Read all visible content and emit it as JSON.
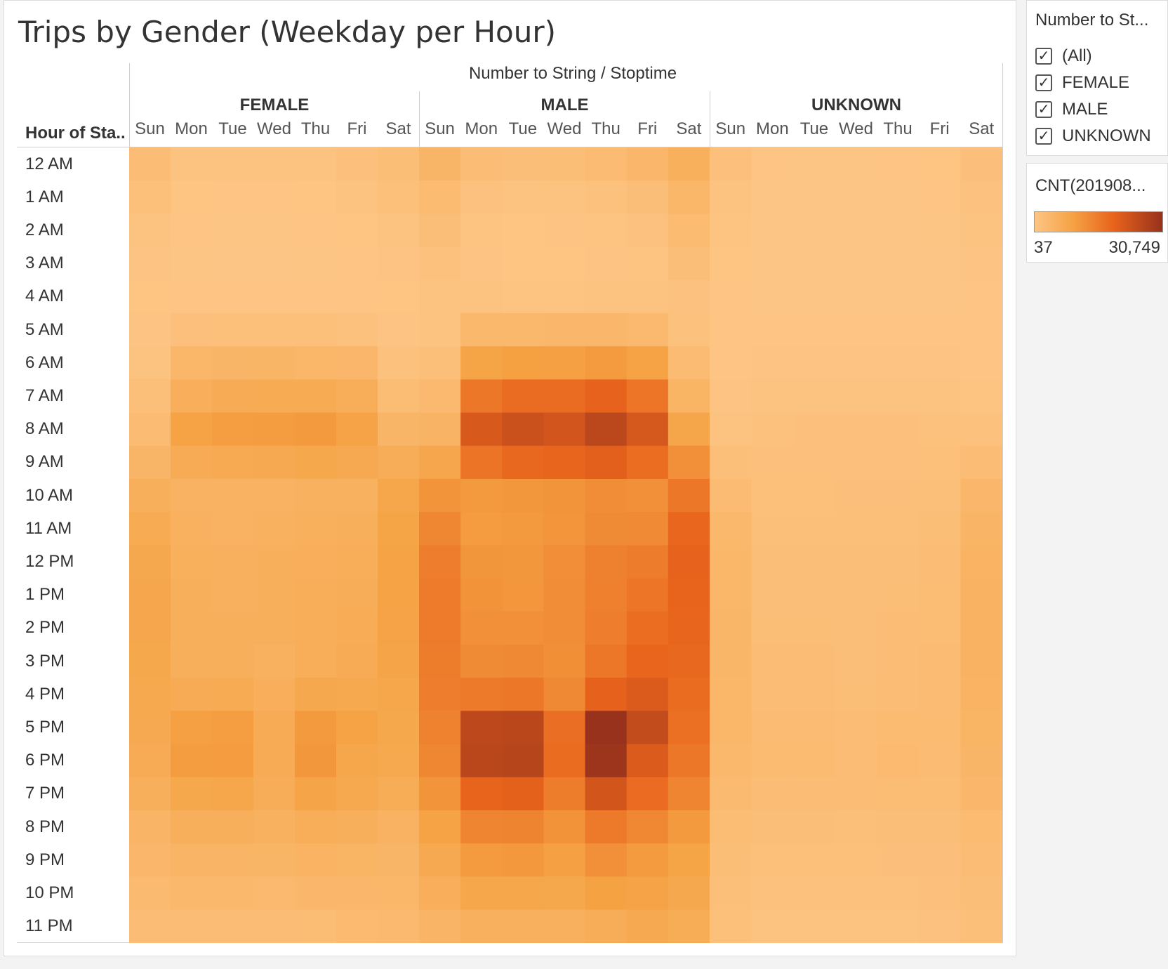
{
  "title": "Trips by Gender (Weekday per Hour)",
  "column_header": "Number to String / Stoptime",
  "row_header": "Hour of Sta..",
  "filter": {
    "title": "Number to St...",
    "items": [
      {
        "label": "(All)",
        "checked": true
      },
      {
        "label": "FEMALE",
        "checked": true
      },
      {
        "label": "MALE",
        "checked": true
      },
      {
        "label": "UNKNOWN",
        "checked": true
      }
    ]
  },
  "color_legend": {
    "title": "CNT(201908...",
    "min_label": "37",
    "max_label": "30,749",
    "colors": [
      "#fdc585",
      "#f5a243",
      "#e8631c",
      "#98321c"
    ]
  },
  "chart_data": {
    "type": "heatmap",
    "title": "Trips by Gender (Weekday per Hour)",
    "column_group_label": "Number to String / Stoptime",
    "row_label": "Hour of Sta..",
    "groups": [
      "FEMALE",
      "MALE",
      "UNKNOWN"
    ],
    "days": [
      "Sun",
      "Mon",
      "Tue",
      "Wed",
      "Thu",
      "Fri",
      "Sat"
    ],
    "hours": [
      "12 AM",
      "1 AM",
      "2 AM",
      "3 AM",
      "4 AM",
      "5 AM",
      "6 AM",
      "7 AM",
      "8 AM",
      "9 AM",
      "10 AM",
      "11 AM",
      "12 PM",
      "1 PM",
      "2 PM",
      "3 PM",
      "4 PM",
      "5 PM",
      "6 PM",
      "7 PM",
      "8 PM",
      "9 PM",
      "10 PM",
      "11 PM"
    ],
    "value_range": [
      37,
      30749
    ],
    "values": {
      "FEMALE": [
        [
          2200,
          900,
          700,
          700,
          900,
          1300,
          2000
        ],
        [
          1400,
          400,
          300,
          300,
          400,
          700,
          1400
        ],
        [
          900,
          200,
          150,
          150,
          200,
          400,
          900
        ],
        [
          500,
          150,
          100,
          100,
          150,
          200,
          500
        ],
        [
          400,
          250,
          200,
          200,
          250,
          250,
          400
        ],
        [
          450,
          1300,
          1400,
          1400,
          1400,
          1200,
          500
        ],
        [
          900,
          3800,
          4200,
          4300,
          4000,
          3600,
          1200
        ],
        [
          1700,
          6000,
          6800,
          7000,
          7000,
          6200,
          2500
        ],
        [
          2600,
          9000,
          9800,
          10000,
          10600,
          8900,
          4200
        ],
        [
          4200,
          6800,
          7200,
          7300,
          7800,
          7300,
          6500
        ],
        [
          5800,
          5000,
          5000,
          5100,
          5400,
          5400,
          8000
        ],
        [
          7000,
          5200,
          5100,
          5400,
          5600,
          5700,
          8800
        ],
        [
          7700,
          5600,
          5500,
          5900,
          6000,
          6200,
          9100
        ],
        [
          7900,
          5700,
          5500,
          5900,
          6200,
          6500,
          9000
        ],
        [
          7900,
          5700,
          5800,
          5800,
          6200,
          6700,
          8900
        ],
        [
          7800,
          5900,
          5900,
          5400,
          6300,
          6800,
          8600
        ],
        [
          7500,
          6800,
          7000,
          6000,
          7700,
          7500,
          8200
        ],
        [
          7300,
          9600,
          9800,
          6800,
          10500,
          9000,
          7800
        ],
        [
          6800,
          10000,
          10200,
          6900,
          11000,
          8200,
          7400
        ],
        [
          5800,
          7800,
          8000,
          6500,
          8600,
          7400,
          6600
        ],
        [
          4500,
          5800,
          5800,
          5300,
          6300,
          5800,
          5000
        ],
        [
          3600,
          4500,
          4500,
          4300,
          4800,
          4600,
          4200
        ],
        [
          3000,
          3400,
          3400,
          3300,
          3700,
          3700,
          3800
        ],
        [
          2300,
          2200,
          2200,
          2300,
          2500,
          2900,
          3200
        ]
      ],
      "MALE": [
        [
          4200,
          2200,
          1900,
          2000,
          2600,
          3600,
          5600
        ],
        [
          2800,
          1000,
          800,
          900,
          1100,
          1800,
          4000
        ],
        [
          1900,
          600,
          400,
          500,
          600,
          1000,
          2800
        ],
        [
          1100,
          500,
          400,
          400,
          500,
          600,
          1800
        ],
        [
          700,
          700,
          600,
          650,
          700,
          700,
          1000
        ],
        [
          800,
          3400,
          3500,
          3600,
          3700,
          3300,
          1200
        ],
        [
          1600,
          8800,
          9400,
          9600,
          10300,
          9000,
          2700
        ],
        [
          3100,
          16000,
          17600,
          17600,
          19200,
          16300,
          4600
        ],
        [
          4700,
          21400,
          23500,
          22500,
          25700,
          21800,
          8300
        ],
        [
          7900,
          16400,
          18300,
          18800,
          20000,
          17500,
          12000
        ],
        [
          11500,
          10600,
          11000,
          11500,
          12600,
          12000,
          16000
        ],
        [
          13600,
          10200,
          10600,
          11300,
          12900,
          13000,
          18600
        ],
        [
          14900,
          11200,
          10900,
          12400,
          14400,
          15000,
          19200
        ],
        [
          15400,
          11600,
          11100,
          12600,
          14600,
          16300,
          19000
        ],
        [
          15300,
          12000,
          12000,
          12600,
          14800,
          17500,
          18800
        ],
        [
          15200,
          12800,
          13200,
          12200,
          16000,
          18700,
          18300
        ],
        [
          14800,
          15500,
          16000,
          13200,
          19500,
          21000,
          17700
        ],
        [
          14300,
          25400,
          25800,
          17400,
          30749,
          24500,
          17000
        ],
        [
          13500,
          25800,
          26300,
          17700,
          30000,
          21000,
          16000
        ],
        [
          11500,
          19000,
          19600,
          15200,
          22300,
          17800,
          13700
        ],
        [
          9000,
          13800,
          14000,
          11800,
          15600,
          13400,
          10500
        ],
        [
          7300,
          10400,
          10800,
          9600,
          12000,
          10400,
          8800
        ],
        [
          6000,
          8000,
          8200,
          7800,
          9300,
          8900,
          7600
        ],
        [
          4400,
          5500,
          5500,
          5500,
          6500,
          7300,
          6600
        ]
      ],
      "UNKNOWN": [
        [
          1300,
          200,
          150,
          150,
          200,
          400,
          1500
        ],
        [
          900,
          100,
          80,
          80,
          100,
          250,
          1000
        ],
        [
          600,
          60,
          50,
          50,
          60,
          150,
          700
        ],
        [
          400,
          50,
          37,
          40,
          50,
          80,
          500
        ],
        [
          300,
          60,
          50,
          50,
          60,
          70,
          300
        ],
        [
          250,
          200,
          200,
          200,
          200,
          180,
          250
        ],
        [
          300,
          500,
          500,
          500,
          500,
          450,
          350
        ],
        [
          500,
          800,
          850,
          850,
          850,
          800,
          600
        ],
        [
          900,
          1200,
          1300,
          1300,
          1300,
          1200,
          1200
        ],
        [
          1600,
          1300,
          1300,
          1300,
          1300,
          1400,
          2300
        ],
        [
          2700,
          1400,
          1400,
          1500,
          1500,
          1700,
          3600
        ],
        [
          3400,
          1600,
          1600,
          1700,
          1700,
          2000,
          4400
        ],
        [
          3800,
          1800,
          1800,
          1800,
          1900,
          2300,
          4800
        ],
        [
          4000,
          1900,
          1900,
          1800,
          2000,
          2400,
          5000
        ],
        [
          4100,
          2000,
          2000,
          1800,
          2100,
          2500,
          5100
        ],
        [
          4100,
          2100,
          2100,
          1900,
          2200,
          2600,
          5000
        ],
        [
          4000,
          2200,
          2200,
          2000,
          2300,
          2600,
          4900
        ],
        [
          3800,
          2700,
          2700,
          2200,
          2800,
          2800,
          4600
        ],
        [
          3500,
          2800,
          2800,
          2300,
          2900,
          2700,
          4200
        ],
        [
          3000,
          2300,
          2300,
          2100,
          2400,
          2400,
          3600
        ],
        [
          2500,
          1800,
          1800,
          1700,
          1900,
          1900,
          2800
        ],
        [
          2000,
          1400,
          1400,
          1400,
          1500,
          1500,
          2200
        ],
        [
          1700,
          1100,
          1100,
          1100,
          1200,
          1300,
          1900
        ],
        [
          1400,
          700,
          700,
          700,
          800,
          1000,
          1700
        ]
      ]
    }
  }
}
